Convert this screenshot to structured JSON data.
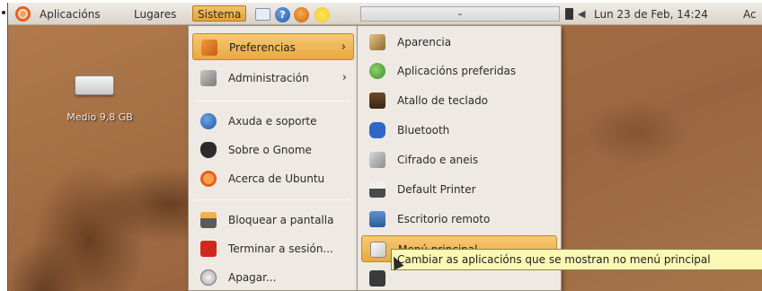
{
  "panel": {
    "menus": [
      "Aplicacións",
      "Lugares",
      "Sistema"
    ],
    "clock": "Lun 23 de Feb, 14:24",
    "extra": "Ac"
  },
  "desktop": {
    "drive_label": "Medio 9,8 GB"
  },
  "sistema_menu": {
    "items": [
      {
        "label": "Preferencias",
        "icon": "preferences-icon",
        "submenu": true,
        "active": true
      },
      {
        "label": "Administración",
        "icon": "administration-icon",
        "submenu": true
      },
      {
        "label": "Axuda e soporte",
        "icon": "help-icon"
      },
      {
        "label": "Sobre o Gnome",
        "icon": "gnome-foot-icon"
      },
      {
        "label": "Acerca de Ubuntu",
        "icon": "ubuntu-icon"
      },
      {
        "label": "Bloquear a pantalla",
        "icon": "lock-screen-icon"
      },
      {
        "label": "Terminar a sesión...",
        "icon": "logout-icon"
      },
      {
        "label": "Apagar...",
        "icon": "shutdown-icon"
      }
    ]
  },
  "preferencias_menu": {
    "items": [
      {
        "label": "Aparencia",
        "icon": "appearance-icon"
      },
      {
        "label": "Aplicacións preferidas",
        "icon": "preferred-apps-icon"
      },
      {
        "label": "Atallo de teclado",
        "icon": "keyboard-icon"
      },
      {
        "label": "Bluetooth",
        "icon": "bluetooth-icon"
      },
      {
        "label": "Cifrado e aneis",
        "icon": "encryption-icon"
      },
      {
        "label": "Default Printer",
        "icon": "printer-icon"
      },
      {
        "label": "Escritorio remoto",
        "icon": "remote-desktop-icon"
      },
      {
        "label": "Menú principal",
        "icon": "main-menu-icon",
        "highlighted": true
      }
    ]
  },
  "tooltip": "Cambiar as aplicacións que se mostran no menú principal",
  "colors": {
    "highlight": "#e9a93f",
    "menu_bg": "#eeeae3",
    "tooltip_bg": "#fbf7b4",
    "ubuntu_orange": "#e85f18"
  }
}
